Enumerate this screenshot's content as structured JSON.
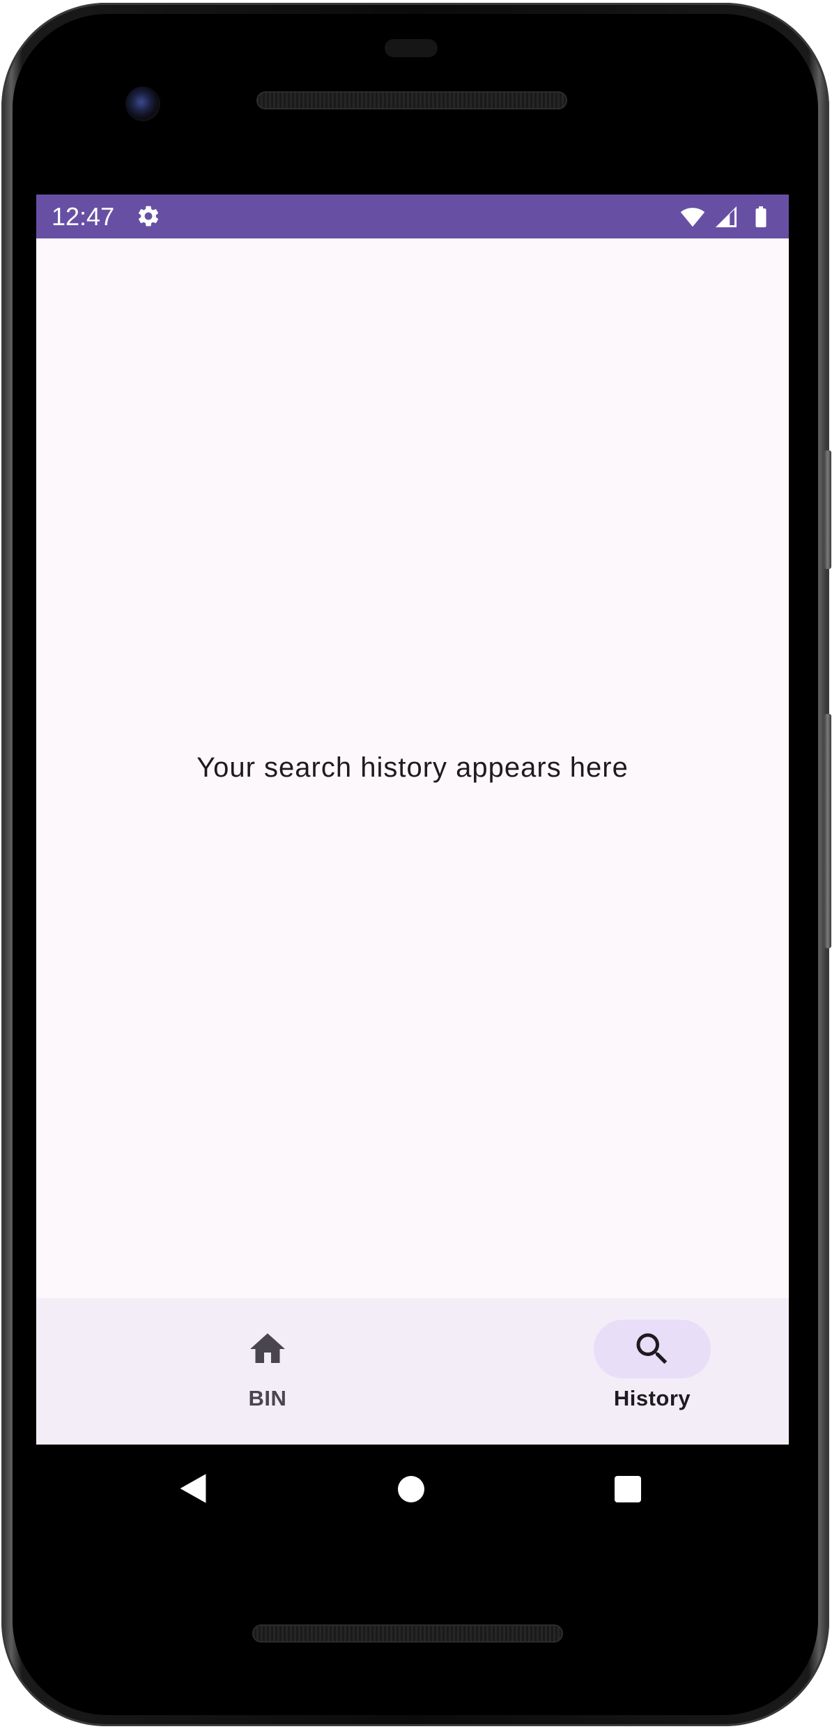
{
  "status_bar": {
    "time": "12:47",
    "background_color": "#6750A4",
    "icons": [
      "gear-icon",
      "wifi-icon",
      "signal-icon",
      "battery-icon"
    ]
  },
  "main": {
    "empty_message": "Your search history appears here"
  },
  "bottom_nav": {
    "items": [
      {
        "label": "BIN",
        "icon": "home-icon",
        "selected": false
      },
      {
        "label": "History",
        "icon": "search-icon",
        "selected": true
      }
    ],
    "selected_indicator_color": "#E8DEF8"
  },
  "system_nav": {
    "buttons": [
      "back-icon",
      "home-circle-icon",
      "recents-icon"
    ]
  },
  "colors": {
    "primary": "#6750A4",
    "surface": "#FDF8FC",
    "nav_surface": "#F3EDF7",
    "on_surface": "#1D1B20"
  }
}
